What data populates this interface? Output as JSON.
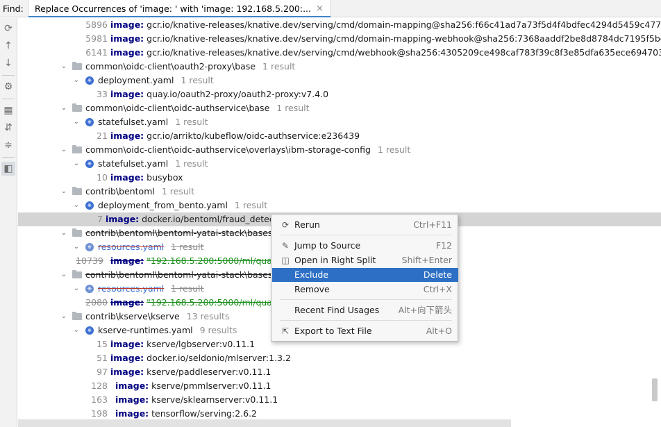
{
  "find": {
    "label": "Find:",
    "tab_title": "Replace Occurrences of 'image: ' with 'image: 192.168.5.200:...",
    "close_glyph": "×"
  },
  "toolstrip": {
    "icons": [
      "rerun-icon",
      "up-arrow-icon",
      "down-arrow-icon",
      "settings-icon",
      "group-icon",
      "expand-all-icon",
      "collapse-all-icon",
      "preview-icon"
    ]
  },
  "tree": {
    "rows": [
      {
        "kind": "line",
        "line": "5896",
        "prefix": "image:",
        "text": "gcr.io/knative-releases/knative.dev/serving/cmd/domain-mapping@sha256:f66c41ad7a73f5d4f4bdfec4294d5459c477f09f3ce5"
      },
      {
        "kind": "line",
        "line": "5981",
        "prefix": "image:",
        "text": "gcr.io/knative-releases/knative.dev/serving/cmd/domain-mapping-webhook@sha256:7368aaddf2be8d8784dc7195f5bc272ecf"
      },
      {
        "kind": "line",
        "line": "6141",
        "prefix": "image:",
        "text": "gcr.io/knative-releases/knative.dev/serving/cmd/webhook@sha256:4305209ce498caf783f39c8f3e85dfa635ece6947033bf50b0b"
      },
      {
        "kind": "folder",
        "name": "common\\oidc-client\\oauth2-proxy\\base",
        "count": "1 result"
      },
      {
        "kind": "file",
        "name": "deployment.yaml",
        "count": "1 result"
      },
      {
        "kind": "line",
        "line": "33",
        "prefix": "image:",
        "text": "quay.io/oauth2-proxy/oauth2-proxy:v7.4.0"
      },
      {
        "kind": "folder",
        "name": "common\\oidc-client\\oidc-authservice\\base",
        "count": "1 result"
      },
      {
        "kind": "file",
        "name": "statefulset.yaml",
        "count": "1 result"
      },
      {
        "kind": "line",
        "line": "21",
        "prefix": "image:",
        "text": "gcr.io/arrikto/kubeflow/oidc-authservice:e236439"
      },
      {
        "kind": "folder",
        "name": "common\\oidc-client\\oidc-authservice\\overlays\\ibm-storage-config",
        "count": "1 result"
      },
      {
        "kind": "file",
        "name": "statefulset.yaml",
        "count": "1 result"
      },
      {
        "kind": "line",
        "line": "10",
        "prefix": "image:",
        "text": "busybox"
      },
      {
        "kind": "folder",
        "name": "contrib\\bentoml",
        "count": "1 result"
      },
      {
        "kind": "file",
        "name": "deployment_from_bento.yaml",
        "count": "1 result"
      },
      {
        "kind": "line",
        "line": "7",
        "prefix": "image:",
        "text": "docker.io/bentoml/fraud_detectio",
        "selected": true
      },
      {
        "kind": "folder",
        "name": "contrib\\bentoml\\bentoml-yatai-stack\\bases\\ya",
        "count": "",
        "excluded": true
      },
      {
        "kind": "file",
        "name": "resources.yaml",
        "count": "1 result",
        "excluded": true
      },
      {
        "kind": "line",
        "line": "10739",
        "prefix": "image:",
        "text": "\"192.168.5.200:5000/ml/quay",
        "excluded": true
      },
      {
        "kind": "folder",
        "name": "contrib\\bentoml\\bentoml-yatai-stack\\bases\\ya",
        "count": "",
        "excluded": true
      },
      {
        "kind": "file",
        "name": "resources.yaml",
        "count": "1 result",
        "excluded": true
      },
      {
        "kind": "line",
        "line": "2080",
        "prefix": "image:",
        "text": "\"192.168.5.200:5000/ml/quay.i",
        "excluded": true
      },
      {
        "kind": "folder",
        "name": "contrib\\kserve\\kserve",
        "count": "13 results"
      },
      {
        "kind": "file",
        "name": "kserve-runtimes.yaml",
        "count": "9 results"
      },
      {
        "kind": "line",
        "line": "15",
        "prefix": "image:",
        "text": "kserve/lgbserver:v0.11.1"
      },
      {
        "kind": "line",
        "line": "51",
        "prefix": "image:",
        "text": "docker.io/seldonio/mlserver:1.3.2"
      },
      {
        "kind": "line",
        "line": "97",
        "prefix": "image:",
        "text": "kserve/paddleserver:v0.11.1"
      },
      {
        "kind": "line",
        "line": "128",
        "prefix": "image:",
        "text": "kserve/pmmlserver:v0.11.1"
      },
      {
        "kind": "line",
        "line": "163",
        "prefix": "image:",
        "text": "kserve/sklearnserver:v0.11.1"
      },
      {
        "kind": "line",
        "line": "198",
        "prefix": "image:",
        "text": "tensorflow/serving:2.6.2"
      }
    ]
  },
  "context_menu": {
    "items": [
      {
        "label": "Rerun",
        "shortcut": "Ctrl+F11",
        "icon": "rerun-icon",
        "glyph": "⟳"
      },
      {
        "label": "Jump to Source",
        "shortcut": "F12",
        "icon": "pencil-icon",
        "glyph": "✎"
      },
      {
        "label": "Open in Right Split",
        "shortcut": "Shift+Enter",
        "icon": "split-icon",
        "glyph": "◫"
      },
      {
        "label": "Exclude",
        "shortcut": "Delete",
        "icon": "",
        "glyph": ""
      },
      {
        "label": "Remove",
        "shortcut": "Ctrl+X",
        "icon": "",
        "glyph": ""
      },
      {
        "label": "Recent Find Usages",
        "shortcut": "Alt+向下箭头",
        "icon": "",
        "glyph": ""
      },
      {
        "label": "Export to Text File",
        "shortcut": "Alt+O",
        "icon": "export-icon",
        "glyph": "⇱"
      }
    ],
    "highlighted": "Exclude"
  },
  "colors": {
    "selection": "#d4d4d4",
    "menu_highlight": "#2d6fc4",
    "keyword": "#000080",
    "excluded_text": "#1a8f1a"
  }
}
